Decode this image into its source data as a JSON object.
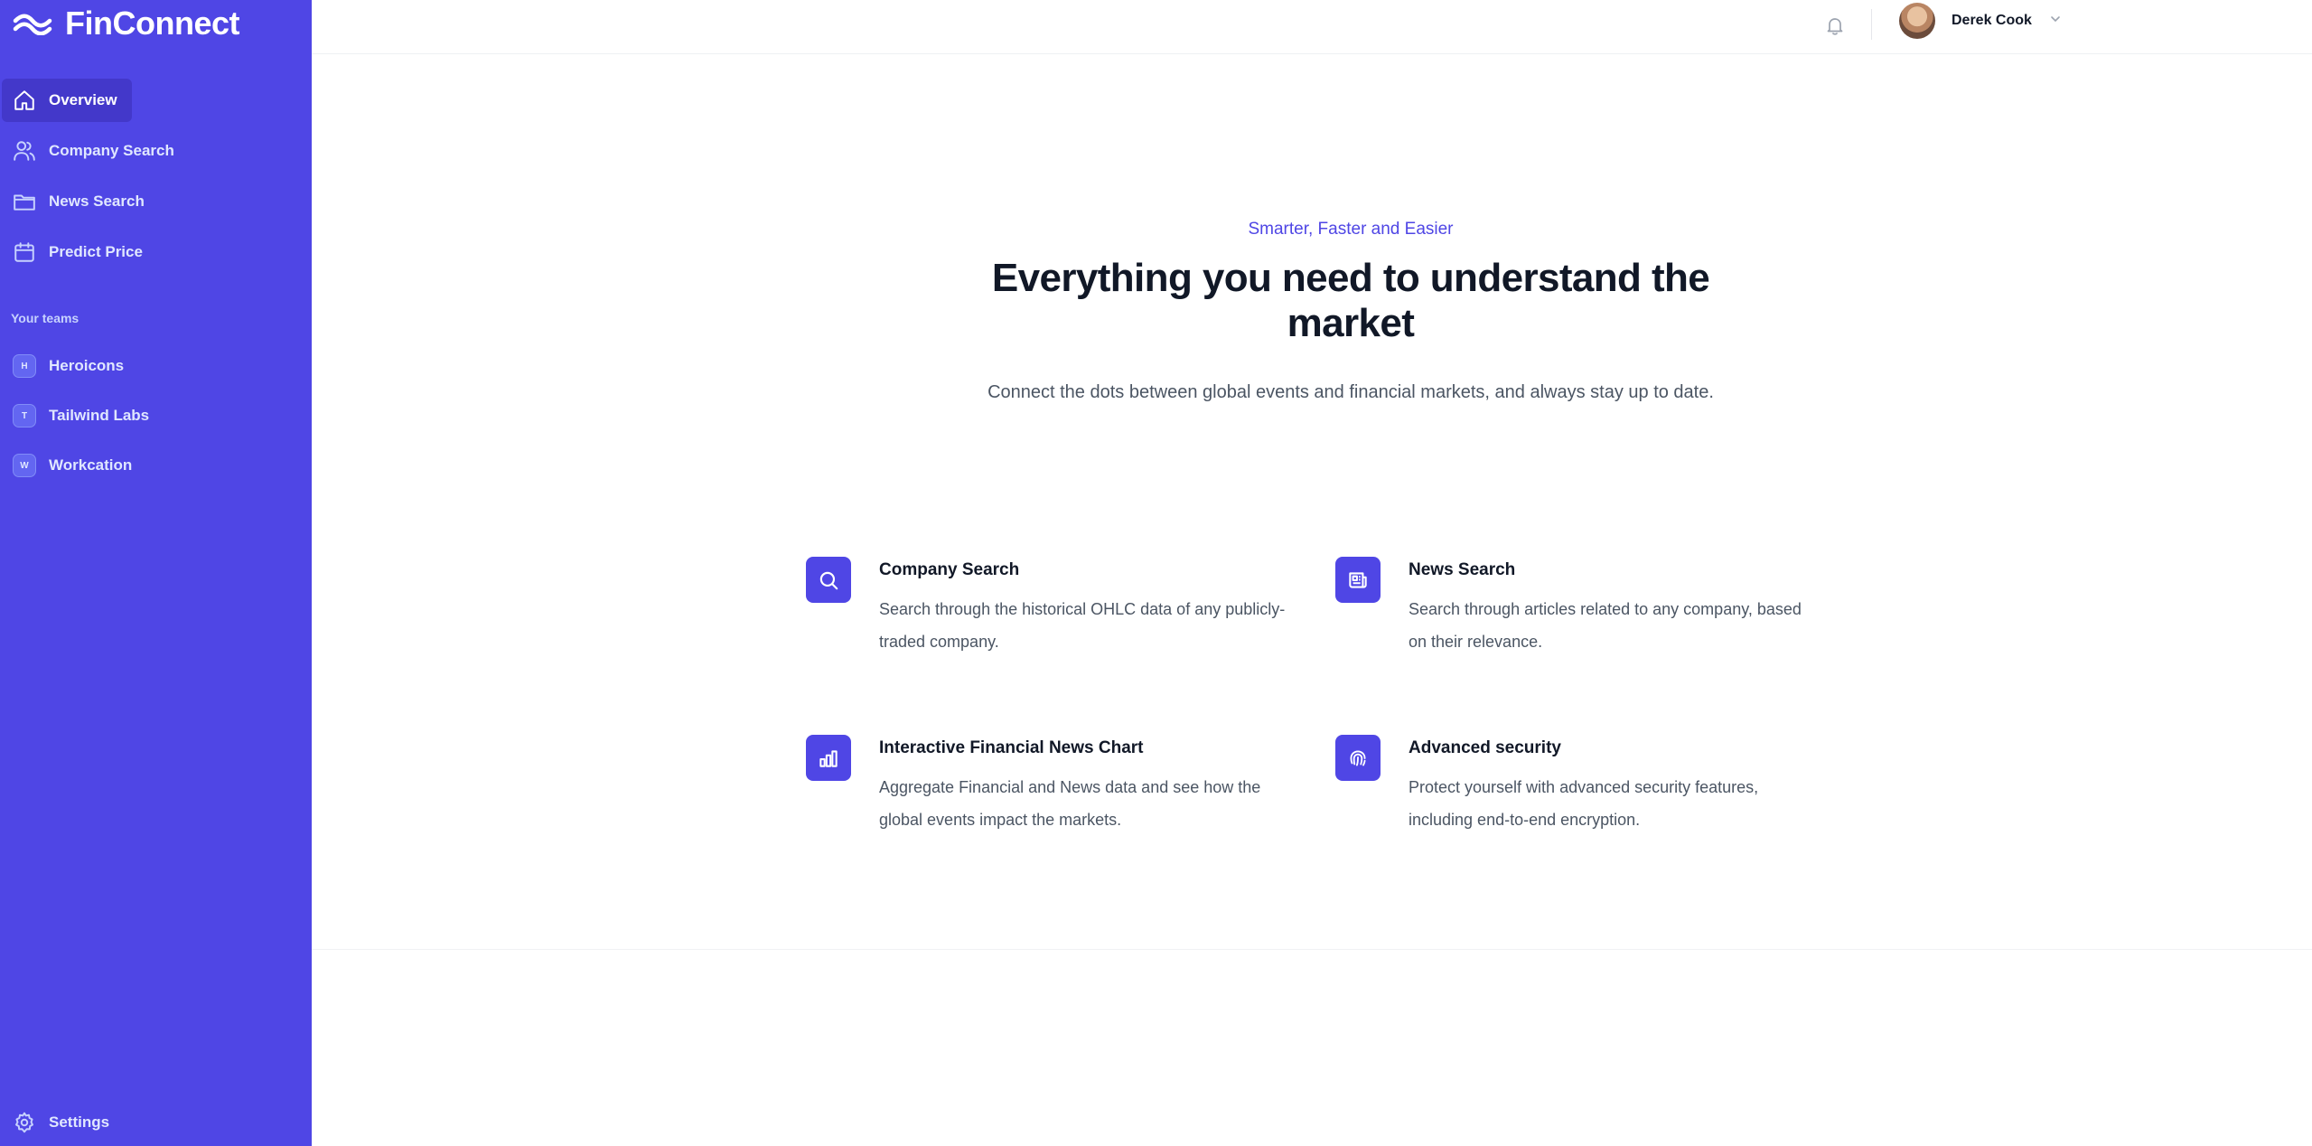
{
  "app": {
    "name": "FinConnect"
  },
  "nav": {
    "items": [
      {
        "label": "Overview",
        "icon": "home-icon",
        "active": true
      },
      {
        "label": "Company Search",
        "icon": "users-icon",
        "active": false
      },
      {
        "label": "News Search",
        "icon": "folder-icon",
        "active": false
      },
      {
        "label": "Predict Price",
        "icon": "calendar-icon",
        "active": false
      }
    ],
    "teams_heading": "Your teams",
    "teams": [
      {
        "initial": "H",
        "label": "Heroicons"
      },
      {
        "initial": "T",
        "label": "Tailwind Labs"
      },
      {
        "initial": "W",
        "label": "Workcation"
      }
    ],
    "settings_label": "Settings"
  },
  "header": {
    "notification_icon": "bell-icon",
    "user_name": "Derek Cook"
  },
  "hero": {
    "eyebrow": "Smarter, Faster and Easier",
    "title": "Everything you need to understand the market",
    "subtitle": "Connect the dots between global events and financial markets, and always stay up to date."
  },
  "features": [
    {
      "title": "Company Search",
      "description": "Search through the historical OHLC data of any publicly-traded company.",
      "icon": "search-icon"
    },
    {
      "title": "News Search",
      "description": "Search through articles related to any company, based on their relevance.",
      "icon": "newspaper-icon"
    },
    {
      "title": "Interactive Financial News Chart",
      "description": "Aggregate Financial and News data and see how the global events impact the markets.",
      "icon": "chart-icon"
    },
    {
      "title": "Advanced security",
      "description": "Protect yourself with advanced security features, including end-to-end encryption.",
      "icon": "fingerprint-icon"
    }
  ],
  "colors": {
    "brand": "#4f46e5",
    "brand_dark": "#4338ca",
    "text": "#111827",
    "muted": "#4b5563"
  }
}
